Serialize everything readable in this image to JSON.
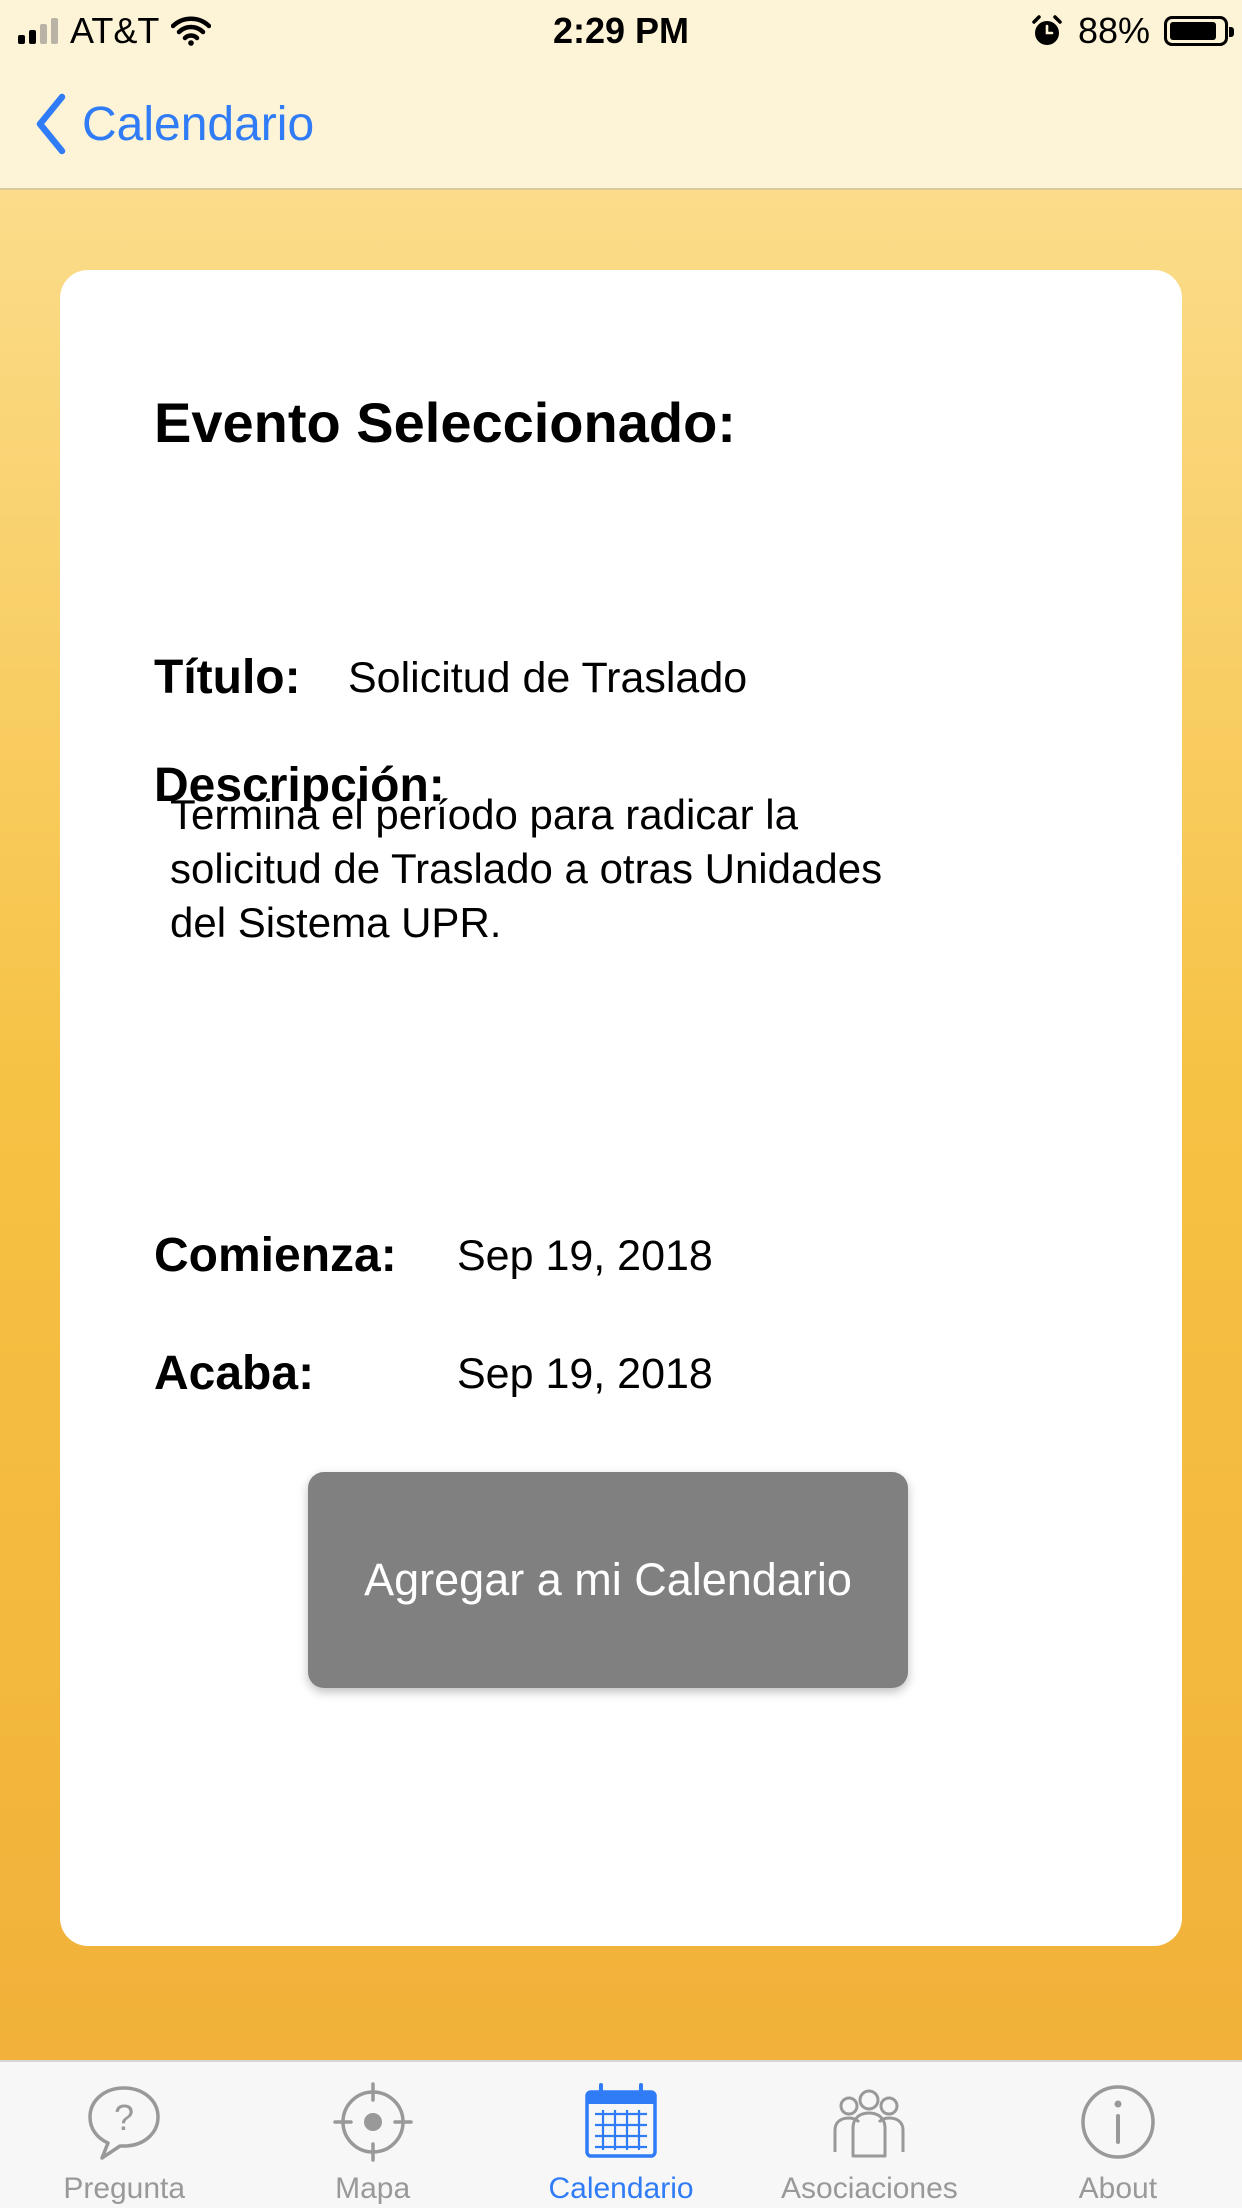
{
  "status_bar": {
    "carrier": "AT&T",
    "time": "2:29 PM",
    "battery": "88%",
    "battery_level": 0.88,
    "icons": [
      "signal-icon",
      "wifi-icon",
      "alarm-icon",
      "battery-icon"
    ]
  },
  "nav": {
    "back_label": "Calendario",
    "back_icon": "chevron-left-icon",
    "accent_color": "#2f7cf6"
  },
  "event": {
    "heading": "Evento Seleccionado:",
    "title_label": "Título:",
    "title_value": "Solicitud de Traslado",
    "description_label": "Descripción:",
    "description_text": "Termina el período para radicar la solicitud de Traslado a otras Unidades del Sistema UPR.",
    "start_label": "Comienza:",
    "start_value": "Sep 19, 2018",
    "end_label": "Acaba:",
    "end_value": "Sep 19, 2018",
    "add_button_label": "Agregar a mi Calendario"
  },
  "tabs": [
    {
      "label": "Pregunta",
      "icon": "question-bubble-icon",
      "active": false
    },
    {
      "label": "Mapa",
      "icon": "crosshair-icon",
      "active": false
    },
    {
      "label": "Calendario",
      "icon": "calendar-icon",
      "active": true
    },
    {
      "label": "Asociaciones",
      "icon": "people-group-icon",
      "active": false
    },
    {
      "label": "About",
      "icon": "info-icon",
      "active": false
    }
  ]
}
